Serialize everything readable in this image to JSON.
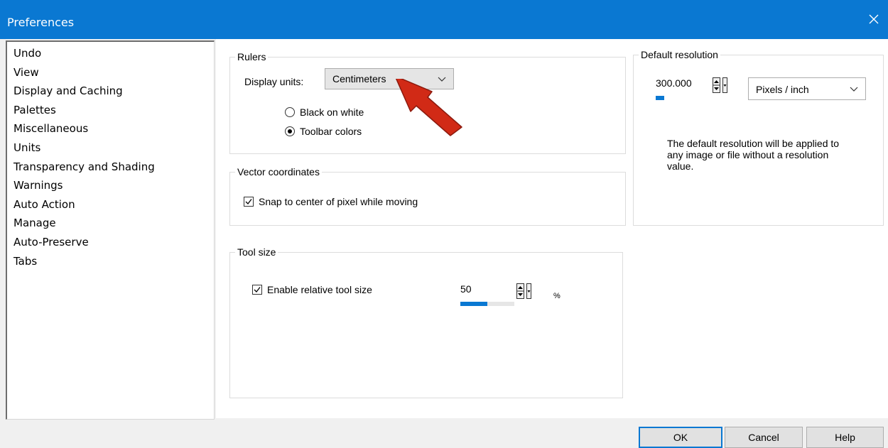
{
  "window": {
    "title": "Preferences"
  },
  "nav": {
    "items": [
      {
        "label": "Undo"
      },
      {
        "label": "View"
      },
      {
        "label": "Display and Caching"
      },
      {
        "label": "Palettes"
      },
      {
        "label": "Miscellaneous"
      },
      {
        "label": "Units",
        "selected": true
      },
      {
        "label": "Transparency and Shading"
      },
      {
        "label": "Warnings"
      },
      {
        "label": "Auto Action"
      },
      {
        "label": "Manage"
      },
      {
        "label": "Auto-Preserve"
      },
      {
        "label": "Tabs"
      }
    ]
  },
  "rulers": {
    "group_label": "Rulers",
    "display_units_label": "Display units:",
    "display_units_value": "Centimeters",
    "radio_black_on_white": "Black on white",
    "radio_toolbar_colors": "Toolbar colors",
    "selected_radio": "Toolbar colors"
  },
  "vector": {
    "group_label": "Vector coordinates",
    "snap_label": "Snap to center of pixel while moving",
    "snap_checked": true
  },
  "tool_size": {
    "group_label": "Tool size",
    "enable_label": "Enable relative tool size",
    "enable_checked": true,
    "value": "50",
    "level_percent": 50,
    "unit": "%"
  },
  "resolution": {
    "group_label": "Default resolution",
    "value": "300.000",
    "unit_value": "Pixels / inch",
    "description": "The default resolution will be applied to any image or file without a resolution value.",
    "description_lines": [
      "The default resolution will be applied to",
      "any image or file without a resolution",
      "value."
    ]
  },
  "buttons": {
    "ok": "OK",
    "cancel": "Cancel",
    "help": "Help"
  },
  "colors": {
    "titlebar": "#0a78d2",
    "accent": "#0a78d2",
    "arrow": "#d12a16"
  },
  "annotation": {
    "icon": "red-arrow-icon"
  }
}
